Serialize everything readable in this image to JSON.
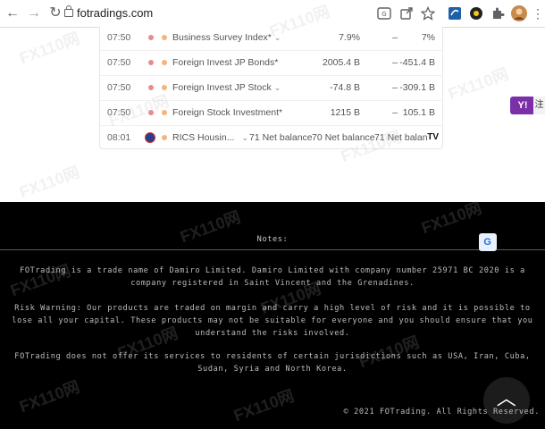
{
  "browser": {
    "url": "fotradings.com",
    "back_icon": "arrow-left-icon",
    "forward_icon": "arrow-right-icon",
    "reload_icon": "reload-icon"
  },
  "calendar": {
    "rows": [
      {
        "time": "07:50",
        "name": "Business Survey Index*",
        "actual": "7.9%",
        "forecast": "–",
        "previous": "7%",
        "has_chevron": true
      },
      {
        "time": "07:50",
        "name": "Foreign Invest JP Bonds*",
        "actual": "2005.4 B",
        "forecast": "–",
        "previous": "-451.4 B",
        "has_chevron": false
      },
      {
        "time": "07:50",
        "name": "Foreign Invest JP Stock",
        "actual": "-74.8 B",
        "forecast": "–",
        "previous": "-309.1 B",
        "has_chevron": true
      },
      {
        "time": "07:50",
        "name": "Foreign Stock Investment*",
        "actual": "1215 B",
        "forecast": "–",
        "previous": "105.1 B",
        "has_chevron": false
      },
      {
        "time": "08:01",
        "name": "RICS Housin...",
        "actual": "71 Net balance",
        "forecast": "70 Net balance",
        "previous": "71 Net balan",
        "has_chevron": true
      }
    ],
    "tv_logo": "TV"
  },
  "yahoo_badge": {
    "label": "Y!",
    "side_text": "注"
  },
  "footer": {
    "notes_title": "Notes:",
    "para1": "FOTrading is a trade name of Damiro Limited. Damiro Limited with company number 25971 BC 2020 is a company registered in Saint Vincent and the Grenadines.",
    "para2": "Risk Warning: Our products are traded on margin and carry a high level of risk and it is possible to lose all your capital. These products may not be suitable for everyone and you should ensure that you understand the risks involved.",
    "para3": "FOTrading does not offer its services to residents of certain jurisdictions such as USA, Iran, Cuba, Sudan, Syria and North Korea.",
    "copyright": "© 2021 FOTrading. All Rights Reserved.",
    "translate_label": "G",
    "totop_label": "︿"
  },
  "watermark": "FX110网"
}
